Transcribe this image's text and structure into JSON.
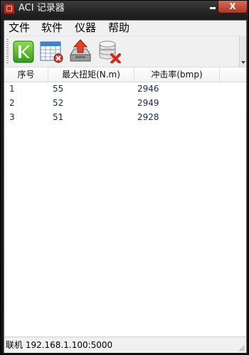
{
  "window": {
    "title": "ACI 记录器",
    "close_glyph": "X"
  },
  "menu": {
    "items": [
      "文件",
      "软件",
      "仪器",
      "帮助"
    ]
  },
  "toolbar": {
    "tools": [
      "k-logo-icon",
      "calendar-delete-icon",
      "upload-tray-icon",
      "database-delete-icon"
    ]
  },
  "table": {
    "columns": [
      "序号",
      "最大扭矩(N.m)",
      "冲击率(bmp)"
    ],
    "rows": [
      [
        "1",
        "55",
        "2946"
      ],
      [
        "2",
        "52",
        "2949"
      ],
      [
        "3",
        "51",
        "2928"
      ]
    ]
  },
  "status": {
    "text": "联机 192.168.1.100:5000"
  },
  "colors": {
    "cell_text": "#1a2a63",
    "close_button": "#b3341f",
    "app_icon": "#b8241f"
  }
}
